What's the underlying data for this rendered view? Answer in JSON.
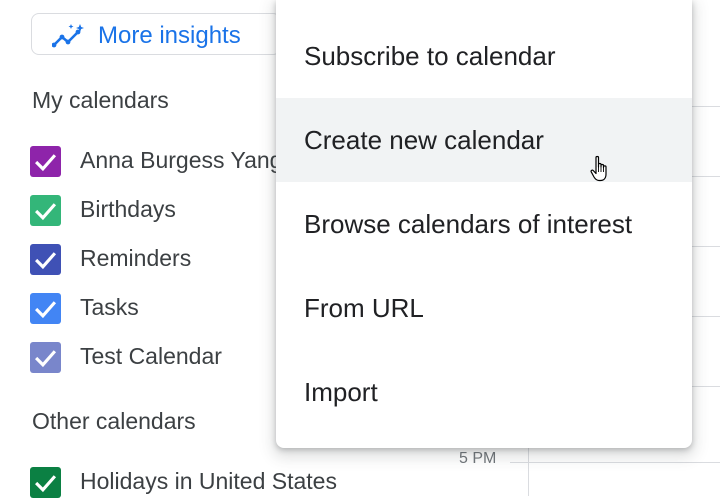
{
  "insights": {
    "label": "More insights",
    "icon": "sparkle-chart-icon"
  },
  "my_calendars": {
    "title": "My calendars",
    "items": [
      {
        "label": "Anna Burgess Yang",
        "color": "#8e24aa",
        "checked": true
      },
      {
        "label": "Birthdays",
        "color": "#33b679",
        "checked": true
      },
      {
        "label": "Reminders",
        "color": "#3f51b5",
        "checked": true
      },
      {
        "label": "Tasks",
        "color": "#4285f4",
        "checked": true
      },
      {
        "label": "Test Calendar",
        "color": "#7986cb",
        "checked": true
      }
    ]
  },
  "other_calendars": {
    "title": "Other calendars",
    "items": [
      {
        "label": "Holidays in United States",
        "color": "#0b8043",
        "checked": true
      }
    ]
  },
  "time_label": "5 PM",
  "menu": {
    "items": [
      {
        "label": "Subscribe to calendar"
      },
      {
        "label": "Create new calendar",
        "hovered": true
      },
      {
        "label": "Browse calendars of interest"
      },
      {
        "label": "From URL"
      },
      {
        "label": "Import"
      }
    ]
  },
  "colors": {
    "accent": "#1a73e8",
    "hover_bg": "#f1f3f4"
  }
}
